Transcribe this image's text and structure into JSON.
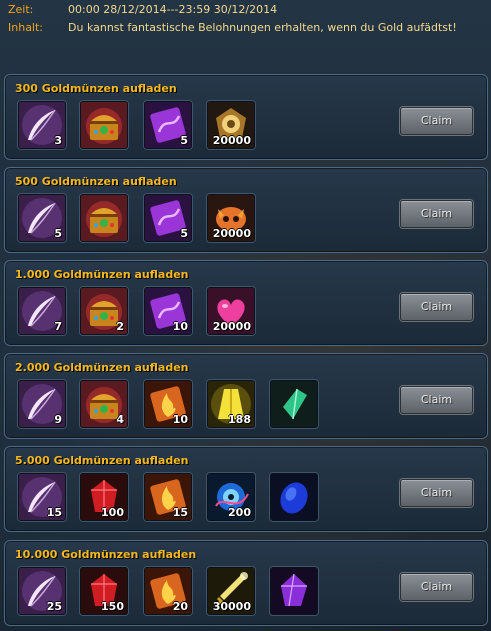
{
  "header": {
    "zeit_label": "Zeit:",
    "zeit_value": "00:00 28/12/2014---23:59 30/12/2014",
    "inhalt_label": "Inhalt:",
    "inhalt_value": "Du kannst fantastische Belohnungen erhalten, wenn du Gold aufädtst!"
  },
  "tiers": [
    {
      "title": "300 Goldmünzen aufladen",
      "claim_label": "Claim",
      "rewards": [
        {
          "icon": "feather-icon",
          "qty": "3"
        },
        {
          "icon": "treasure-chest-icon",
          "qty": ""
        },
        {
          "icon": "purple-scroll-icon",
          "qty": "5"
        },
        {
          "icon": "gold-badge-icon",
          "qty": "20000"
        }
      ]
    },
    {
      "title": "500 Goldmünzen aufladen",
      "claim_label": "Claim",
      "rewards": [
        {
          "icon": "feather-icon",
          "qty": "5"
        },
        {
          "icon": "treasure-chest-icon",
          "qty": ""
        },
        {
          "icon": "purple-scroll-icon",
          "qty": "5"
        },
        {
          "icon": "fox-mask-icon",
          "qty": "20000"
        }
      ]
    },
    {
      "title": "1.000 Goldmünzen aufladen",
      "claim_label": "Claim",
      "rewards": [
        {
          "icon": "feather-icon",
          "qty": "7"
        },
        {
          "icon": "treasure-chest-icon",
          "qty": "2"
        },
        {
          "icon": "purple-scroll-icon",
          "qty": "10"
        },
        {
          "icon": "pink-heart-icon",
          "qty": "20000"
        }
      ]
    },
    {
      "title": "2.000 Goldmünzen aufladen",
      "claim_label": "Claim",
      "rewards": [
        {
          "icon": "feather-icon",
          "qty": "9"
        },
        {
          "icon": "treasure-chest-icon",
          "qty": "4"
        },
        {
          "icon": "fire-scroll-icon",
          "qty": "10"
        },
        {
          "icon": "golden-robe-icon",
          "qty": "188"
        },
        {
          "icon": "green-crystal-icon",
          "qty": ""
        }
      ]
    },
    {
      "title": "5.000 Goldmünzen aufladen",
      "claim_label": "Claim",
      "rewards": [
        {
          "icon": "feather-icon",
          "qty": "15"
        },
        {
          "icon": "red-gem-icon",
          "qty": "100"
        },
        {
          "icon": "fire-scroll-icon",
          "qty": "15"
        },
        {
          "icon": "blue-eye-orb-icon",
          "qty": "200"
        },
        {
          "icon": "blue-stone-icon",
          "qty": ""
        }
      ]
    },
    {
      "title": "10.000 Goldmünzen aufladen",
      "claim_label": "Claim",
      "rewards": [
        {
          "icon": "feather-icon",
          "qty": "25"
        },
        {
          "icon": "red-gem-icon",
          "qty": "150"
        },
        {
          "icon": "fire-scroll-icon",
          "qty": "20"
        },
        {
          "icon": "golden-sword-icon",
          "qty": "30000"
        },
        {
          "icon": "purple-stone-icon",
          "qty": ""
        }
      ]
    }
  ]
}
